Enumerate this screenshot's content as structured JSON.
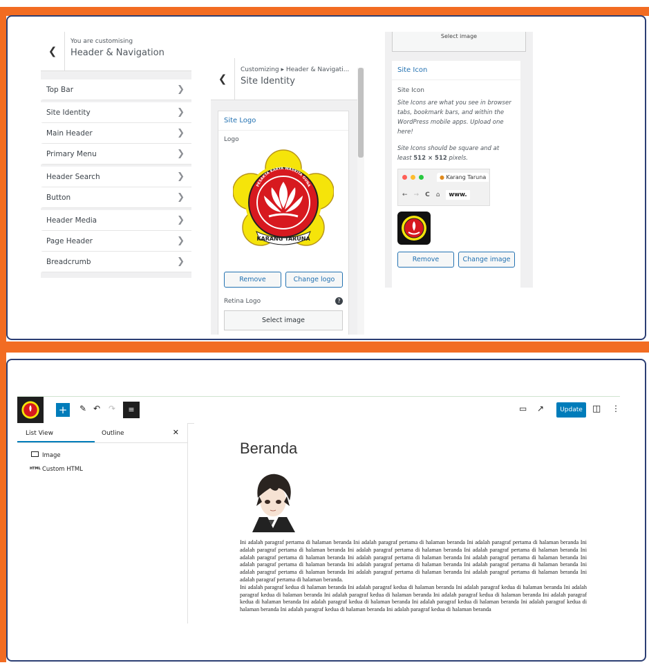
{
  "customizer_main": {
    "subtitle": "You are customising",
    "title": "Header & Navigation",
    "back_icon": "chevron-left-icon",
    "items": [
      {
        "label": "Top Bar"
      },
      {
        "label": "Site Identity"
      },
      {
        "label": "Main Header"
      },
      {
        "label": "Primary Menu"
      },
      {
        "label": "Header Search"
      },
      {
        "label": "Button"
      },
      {
        "label": "Header Media"
      },
      {
        "label": "Page Header"
      },
      {
        "label": "Breadcrumb"
      }
    ]
  },
  "site_identity": {
    "breadcrumb": "Customizing ▸ Header & Navigati...",
    "title": "Site Identity",
    "section_title": "Site Logo",
    "logo_label": "Logo",
    "logo_text_top": "PESAKTA KARYA WASKITA GUNA",
    "logo_text_banner": "KARANG TARUNA",
    "remove_label": "Remove",
    "change_logo_label": "Change logo",
    "retina_label": "Retina Logo",
    "help_glyph": "?",
    "select_image_label": "Select image"
  },
  "site_icon_panel": {
    "top_button_label": "Select image",
    "section_title": "Site Icon",
    "label": "Site Icon",
    "desc_1": "Site Icons are what you see in browser tabs, bookmark bars, and within the WordPress mobile apps. Upload one here!",
    "desc_2a": "Site Icons should be square and at least ",
    "desc_2b": "512 × 512",
    "desc_2c": " pixels.",
    "tab_label": "Karang Taruna",
    "url_text": "www.",
    "remove_label": "Remove",
    "change_image_label": "Change image"
  },
  "editor": {
    "update_label": "Update",
    "list_view_tab": "List View",
    "outline_tab": "Outline",
    "close_glyph": "✕",
    "list_items": [
      {
        "label": "Image",
        "icon": "image-icon"
      },
      {
        "label": "Custom HTML",
        "icon": "html-icon",
        "tag": "HTML"
      }
    ],
    "page_title": "Beranda",
    "paragraph_1": "Ini adalah paragraf pertama di halaman beranda Ini adalah paragraf pertama di halaman beranda Ini adalah paragraf pertama di halaman beranda Ini adalah paragraf pertama di halaman beranda Ini adalah paragraf pertama di halaman beranda Ini adalah paragraf pertama di halaman beranda Ini adalah paragraf pertama di halaman beranda Ini adalah paragraf pertama di halaman beranda Ini adalah paragraf pertama di halaman beranda Ini adalah paragraf pertama di halaman beranda Ini adalah paragraf pertama di halaman beranda Ini adalah paragraf pertama di halaman beranda Ini adalah paragraf pertama di halaman beranda Ini adalah paragraf pertama di halaman beranda Ini adalah paragraf pertama di halaman beranda Ini adalah paragraf pertama di halaman beranda.",
    "paragraph_2": "Ini adalah paragraf kedua di halaman beranda Ini adalah paragraf kedua di halaman beranda Ini adalah paragraf kedua di halaman beranda Ini adalah paragraf kedua di halaman beranda Ini adalah paragraf kedua di halaman beranda Ini adalah paragraf kedua di halaman beranda Ini adalah paragraf kedua di halaman beranda Ini adalah paragraf kedua di halaman beranda Ini adalah paragraf kedua di halaman beranda Ini adalah paragraf kedua di halaman beranda Ini adalah paragraf kedua di halaman beranda Ini adalah paragraf kedua di halaman beranda"
  },
  "colors": {
    "frame_orange": "#f26c22",
    "frame_border": "#2b3e73",
    "wp_blue": "#007cba",
    "link_blue": "#2271b1",
    "logo_yellow": "#f5e40a",
    "logo_red": "#d7191f"
  }
}
